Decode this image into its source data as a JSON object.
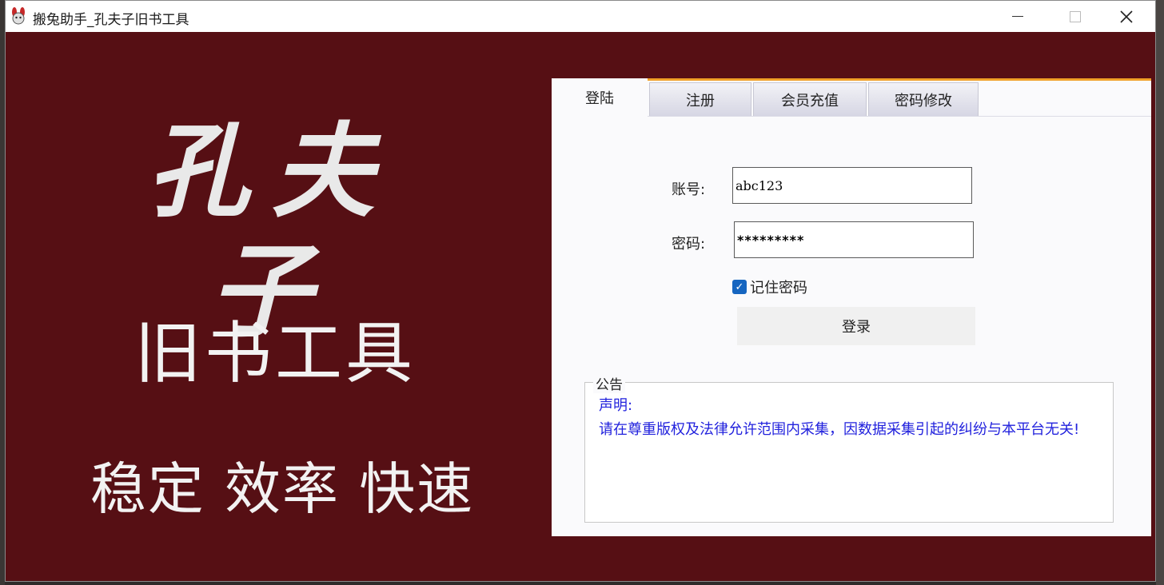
{
  "window": {
    "title": "搬兔助手_孔夫子旧书工具"
  },
  "brand": {
    "main": "孔夫子",
    "sub": "旧书工具",
    "slogan": "稳定  效率  快速"
  },
  "tabs": [
    {
      "label": "登陆",
      "active": true
    },
    {
      "label": "注册",
      "active": false
    },
    {
      "label": "会员充值",
      "active": false
    },
    {
      "label": "密码修改",
      "active": false
    }
  ],
  "login": {
    "account_label": "账号:",
    "account_value": "abc123",
    "password_label": "密码:",
    "password_value": "*********",
    "remember_label": "记住密码",
    "remember_checked": true,
    "submit_label": "登录"
  },
  "notice": {
    "title": "公告",
    "heading": "声明:",
    "body": "请在尊重版权及法律允许范围内采集，因数据采集引起的纠纷与本平台无关!"
  },
  "colors": {
    "brand_bg": "#560f14",
    "tab_accent": "#f0a028",
    "notice_text": "#2222dd",
    "checkbox": "#1565c0"
  }
}
